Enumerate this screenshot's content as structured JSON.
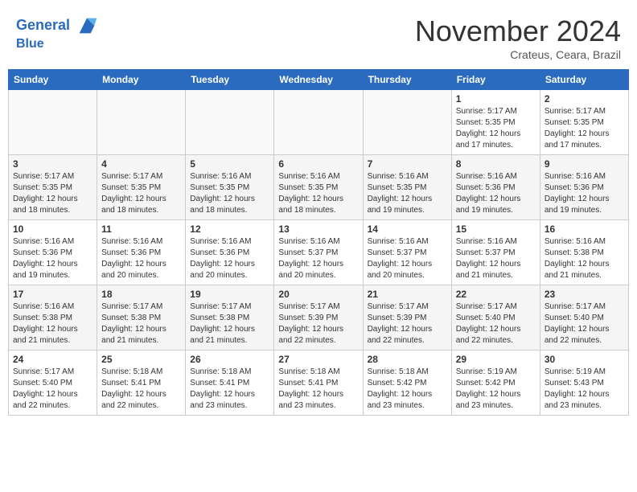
{
  "header": {
    "logo_line1": "General",
    "logo_line2": "Blue",
    "month_title": "November 2024",
    "subtitle": "Crateus, Ceara, Brazil"
  },
  "weekdays": [
    "Sunday",
    "Monday",
    "Tuesday",
    "Wednesday",
    "Thursday",
    "Friday",
    "Saturday"
  ],
  "weeks": [
    [
      {
        "day": "",
        "info": ""
      },
      {
        "day": "",
        "info": ""
      },
      {
        "day": "",
        "info": ""
      },
      {
        "day": "",
        "info": ""
      },
      {
        "day": "",
        "info": ""
      },
      {
        "day": "1",
        "info": "Sunrise: 5:17 AM\nSunset: 5:35 PM\nDaylight: 12 hours and 17 minutes."
      },
      {
        "day": "2",
        "info": "Sunrise: 5:17 AM\nSunset: 5:35 PM\nDaylight: 12 hours and 17 minutes."
      }
    ],
    [
      {
        "day": "3",
        "info": "Sunrise: 5:17 AM\nSunset: 5:35 PM\nDaylight: 12 hours and 18 minutes."
      },
      {
        "day": "4",
        "info": "Sunrise: 5:17 AM\nSunset: 5:35 PM\nDaylight: 12 hours and 18 minutes."
      },
      {
        "day": "5",
        "info": "Sunrise: 5:16 AM\nSunset: 5:35 PM\nDaylight: 12 hours and 18 minutes."
      },
      {
        "day": "6",
        "info": "Sunrise: 5:16 AM\nSunset: 5:35 PM\nDaylight: 12 hours and 18 minutes."
      },
      {
        "day": "7",
        "info": "Sunrise: 5:16 AM\nSunset: 5:35 PM\nDaylight: 12 hours and 19 minutes."
      },
      {
        "day": "8",
        "info": "Sunrise: 5:16 AM\nSunset: 5:36 PM\nDaylight: 12 hours and 19 minutes."
      },
      {
        "day": "9",
        "info": "Sunrise: 5:16 AM\nSunset: 5:36 PM\nDaylight: 12 hours and 19 minutes."
      }
    ],
    [
      {
        "day": "10",
        "info": "Sunrise: 5:16 AM\nSunset: 5:36 PM\nDaylight: 12 hours and 19 minutes."
      },
      {
        "day": "11",
        "info": "Sunrise: 5:16 AM\nSunset: 5:36 PM\nDaylight: 12 hours and 20 minutes."
      },
      {
        "day": "12",
        "info": "Sunrise: 5:16 AM\nSunset: 5:36 PM\nDaylight: 12 hours and 20 minutes."
      },
      {
        "day": "13",
        "info": "Sunrise: 5:16 AM\nSunset: 5:37 PM\nDaylight: 12 hours and 20 minutes."
      },
      {
        "day": "14",
        "info": "Sunrise: 5:16 AM\nSunset: 5:37 PM\nDaylight: 12 hours and 20 minutes."
      },
      {
        "day": "15",
        "info": "Sunrise: 5:16 AM\nSunset: 5:37 PM\nDaylight: 12 hours and 21 minutes."
      },
      {
        "day": "16",
        "info": "Sunrise: 5:16 AM\nSunset: 5:38 PM\nDaylight: 12 hours and 21 minutes."
      }
    ],
    [
      {
        "day": "17",
        "info": "Sunrise: 5:16 AM\nSunset: 5:38 PM\nDaylight: 12 hours and 21 minutes."
      },
      {
        "day": "18",
        "info": "Sunrise: 5:17 AM\nSunset: 5:38 PM\nDaylight: 12 hours and 21 minutes."
      },
      {
        "day": "19",
        "info": "Sunrise: 5:17 AM\nSunset: 5:38 PM\nDaylight: 12 hours and 21 minutes."
      },
      {
        "day": "20",
        "info": "Sunrise: 5:17 AM\nSunset: 5:39 PM\nDaylight: 12 hours and 22 minutes."
      },
      {
        "day": "21",
        "info": "Sunrise: 5:17 AM\nSunset: 5:39 PM\nDaylight: 12 hours and 22 minutes."
      },
      {
        "day": "22",
        "info": "Sunrise: 5:17 AM\nSunset: 5:40 PM\nDaylight: 12 hours and 22 minutes."
      },
      {
        "day": "23",
        "info": "Sunrise: 5:17 AM\nSunset: 5:40 PM\nDaylight: 12 hours and 22 minutes."
      }
    ],
    [
      {
        "day": "24",
        "info": "Sunrise: 5:17 AM\nSunset: 5:40 PM\nDaylight: 12 hours and 22 minutes."
      },
      {
        "day": "25",
        "info": "Sunrise: 5:18 AM\nSunset: 5:41 PM\nDaylight: 12 hours and 22 minutes."
      },
      {
        "day": "26",
        "info": "Sunrise: 5:18 AM\nSunset: 5:41 PM\nDaylight: 12 hours and 23 minutes."
      },
      {
        "day": "27",
        "info": "Sunrise: 5:18 AM\nSunset: 5:41 PM\nDaylight: 12 hours and 23 minutes."
      },
      {
        "day": "28",
        "info": "Sunrise: 5:18 AM\nSunset: 5:42 PM\nDaylight: 12 hours and 23 minutes."
      },
      {
        "day": "29",
        "info": "Sunrise: 5:19 AM\nSunset: 5:42 PM\nDaylight: 12 hours and 23 minutes."
      },
      {
        "day": "30",
        "info": "Sunrise: 5:19 AM\nSunset: 5:43 PM\nDaylight: 12 hours and 23 minutes."
      }
    ]
  ]
}
